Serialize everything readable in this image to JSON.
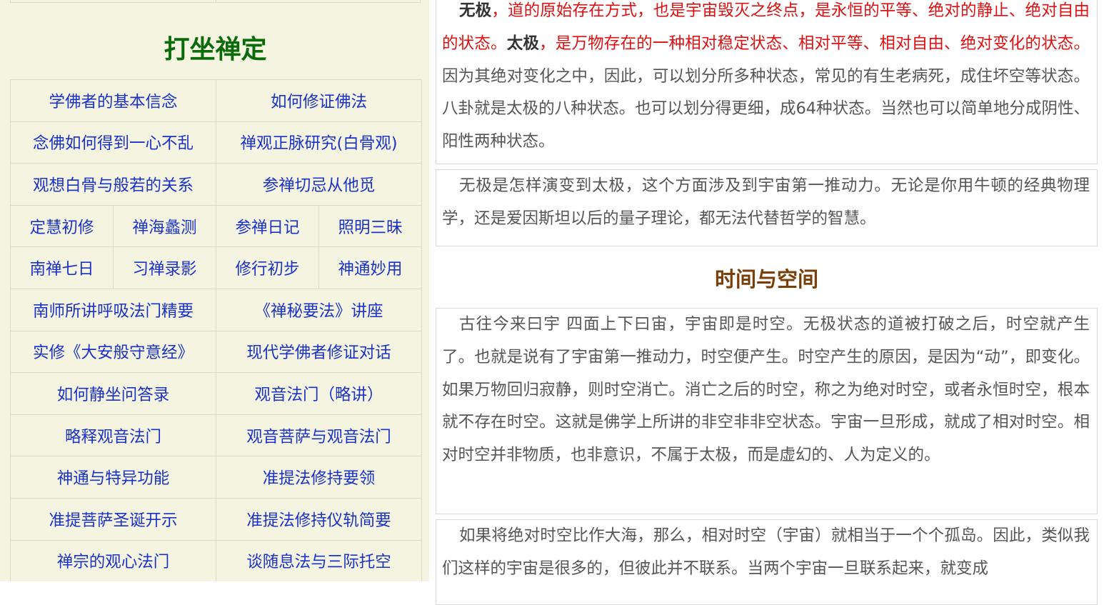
{
  "sidebar": {
    "section_title": "打坐禅定",
    "rows": [
      [
        "学佛者的基本信念",
        "如何修证佛法"
      ],
      [
        "念佛如何得到一心不乱",
        "禅观正脉研究(白骨观)"
      ],
      [
        "观想白骨与般若的关系",
        "参禅切忌从他觅"
      ],
      [
        "定慧初修",
        "禅海蠡测",
        "参禅日记",
        "照明三昧"
      ],
      [
        "南禅七日",
        "习禅录影",
        "修行初步",
        "神通妙用"
      ],
      [
        "南师所讲呼吸法门精要",
        "《禅秘要法》讲座"
      ],
      [
        "实修《大安般守意经》",
        "现代学佛者修证对话"
      ],
      [
        "如何静坐问答录",
        "观音法门（略讲）"
      ],
      [
        "略释观音法门",
        "观音菩萨与观音法门"
      ],
      [
        "神通与特异功能",
        "准提法修持要领"
      ],
      [
        "准提菩萨圣诞开示",
        "准提法修持仪轨简要"
      ],
      [
        "禅宗的观心法门",
        "谈随息法与三际托空"
      ]
    ]
  },
  "article": {
    "p1": {
      "t1_bold": "无极",
      "t1_red": "，道的原始存在方式，也是宇宙毁灭之终点，是永恒的平等、绝对的静止、绝对自由的状态。",
      "t2_bold": "太极",
      "t2_red": "，是万物存在的一种相对稳定状态、相对平等、相对自由、绝对变化的状态。",
      "t3": "因为其绝对变化之中，因此，可以划分所多种状态，常见的有生老病死，成住坏空等状态。八卦就是太极的八种状态。也可以划分得更细，成64种状态。当然也可以简单地分成阴性、阳性两种状态。"
    },
    "p2": "无极是怎样演变到太极，这个方面涉及到宇宙第一推动力。无论是你用牛顿的经典物理学，还是爱因斯坦以后的量子理论，都无法代替哲学的智慧。",
    "heading": "时间与空间",
    "p3": "古往今来曰宇 四面上下曰宙，宇宙即是时空。无极状态的道被打破之后，时空就产生了。也就是说有了宇宙第一推动力，时空便产生。时空产生的原因，是因为“动”，即变化。如果万物回归寂静，则时空消亡。消亡之后的时空，称之为绝对时空，或者永恒时空，根本就不存在时空。这就是佛学上所讲的非空非非空状态。宇宙一旦形成，就成了相对时空。相对时空并非物质，也非意识，不属于太极，而是虚幻的、人为定义的。",
    "p4": "如果将绝对时空比作大海，那么，相对时空（宇宙）就相当于一个个孤岛。因此，类似我们这样的宇宙是很多的，但彼此并不联系。当两个宇宙一旦联系起来，就变成"
  }
}
